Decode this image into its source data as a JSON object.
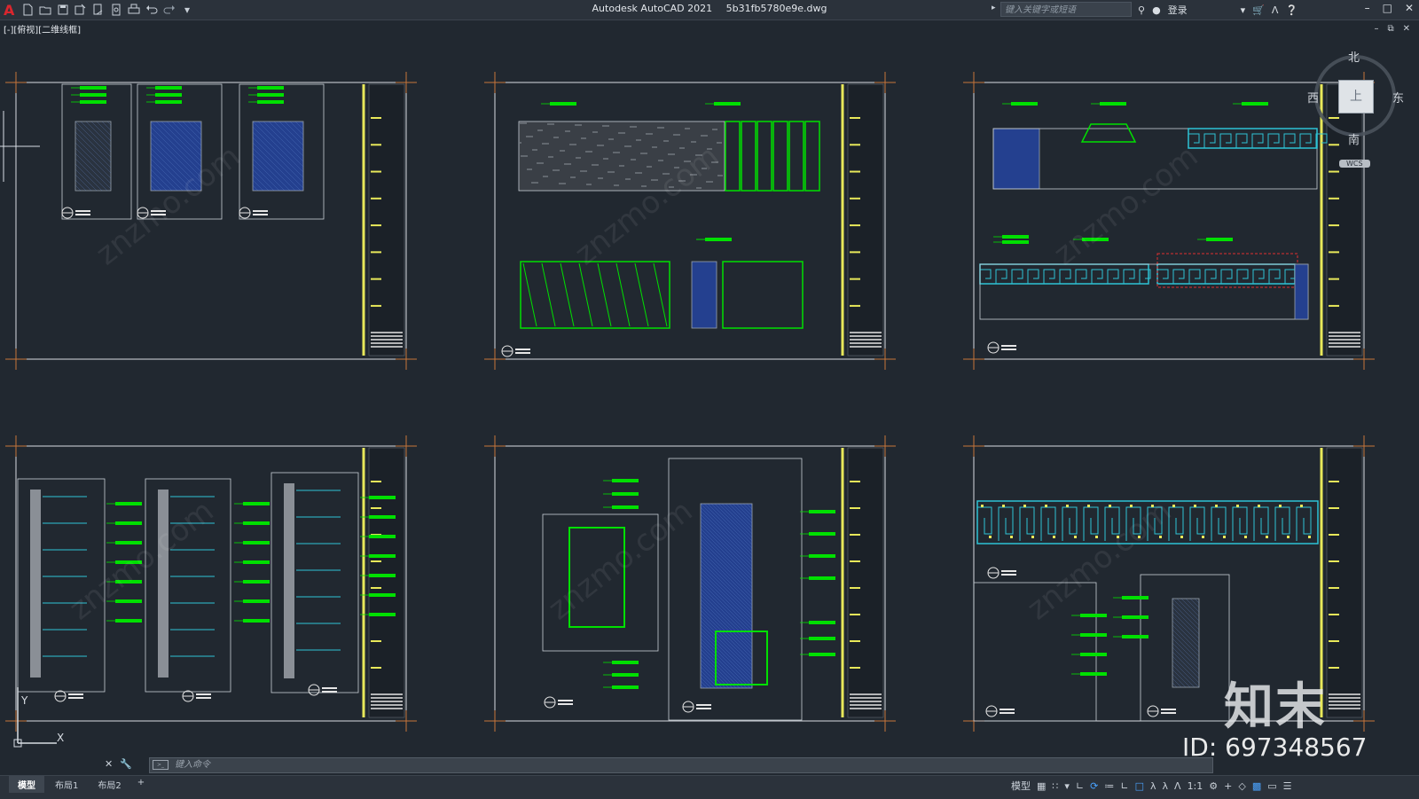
{
  "app": {
    "title": "Autodesk AutoCAD 2021",
    "filename": "5b31fb5780e9e.dwg",
    "logo_letter": "A",
    "accent_color": "#d9262e"
  },
  "quick_access": {
    "icons": [
      "new-icon",
      "open-icon",
      "save-icon",
      "save-as-icon",
      "publish-icon",
      "plot-preview-icon",
      "print-icon",
      "undo-icon",
      "redo-icon",
      "customize-icon"
    ]
  },
  "search": {
    "placeholder": "键入关键字或短语"
  },
  "account": {
    "login_label": "登录"
  },
  "viewport": {
    "label": "[-][俯视][二维线框]"
  },
  "viewcube": {
    "north": "北",
    "south": "南",
    "west": "西",
    "east": "东",
    "face": "上",
    "wcs": "WCS"
  },
  "command": {
    "placeholder": "键入命令"
  },
  "tabs": [
    {
      "label": "模型",
      "active": true
    },
    {
      "label": "布局1",
      "active": false
    },
    {
      "label": "布局2",
      "active": false
    }
  ],
  "status": {
    "model_label": "模型",
    "scale_label": "1:1"
  },
  "ucs": {
    "y_label": "Y",
    "x_label": "X"
  },
  "watermark": {
    "logo_text": "知末",
    "id_text": "ID: 697348567",
    "site_text": "znzmo.com"
  },
  "colors": {
    "background": "#212830",
    "sheet_border": "#d9dde2",
    "annotation_green": "#00e000",
    "title_yellow": "#e8e85a",
    "hatch_blue": "#24408f",
    "cyan_pattern": "#2ec3d6",
    "corner_mark": "#c8763a"
  }
}
